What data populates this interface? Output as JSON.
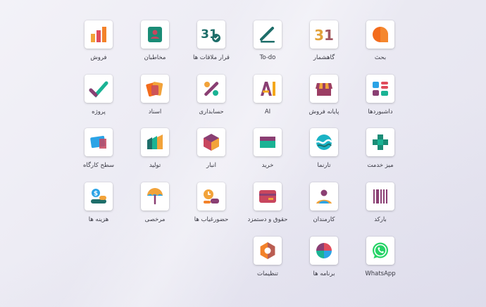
{
  "apps": [
    {
      "id": "discuss",
      "label": "بحث",
      "icon": "discuss-icon",
      "color": "#f36b1c"
    },
    {
      "id": "calendar",
      "label": "گاهشمار",
      "icon": "calendar-icon",
      "color": "#e2a23b"
    },
    {
      "id": "todo",
      "label": "To-do",
      "icon": "todo-icon",
      "color": "#1e6e6a"
    },
    {
      "id": "appointments",
      "label": "قرار ملاقات ها",
      "icon": "appointment-icon",
      "color": "#1e6e6a"
    },
    {
      "id": "contacts",
      "label": "مخاطبان",
      "icon": "contacts-icon",
      "color": "#1a8c76"
    },
    {
      "id": "sales",
      "label": "فروش",
      "icon": "sales-icon",
      "color": "#f2a33a"
    },
    {
      "id": "dashboards",
      "label": "داشبوردها",
      "icon": "dashboards-icon",
      "color": "#e04c5c"
    },
    {
      "id": "pos",
      "label": "پایانه فروش",
      "icon": "pos-icon",
      "color": "#9b3d63"
    },
    {
      "id": "ai",
      "label": "AI",
      "icon": "ai-icon",
      "color": "#f4a71b"
    },
    {
      "id": "accounting",
      "label": "حسابداری",
      "icon": "accounting-icon",
      "color": "#8a3f73"
    },
    {
      "id": "documents",
      "label": "اسناد",
      "icon": "documents-icon",
      "color": "#f3822a"
    },
    {
      "id": "project",
      "label": "پروژه",
      "icon": "project-icon",
      "color": "#1ab394"
    },
    {
      "id": "helpdesk",
      "label": "میز خدمت",
      "icon": "helpdesk-icon",
      "color": "#1a8c76"
    },
    {
      "id": "website",
      "label": "تارنما",
      "icon": "website-icon",
      "color": "#1ab3c5"
    },
    {
      "id": "purchase",
      "label": "خرید",
      "icon": "purchase-icon",
      "color": "#1ab394"
    },
    {
      "id": "inventory",
      "label": "انبار",
      "icon": "inventory-icon",
      "color": "#8a3f73"
    },
    {
      "id": "manufacturing",
      "label": "تولید",
      "icon": "manufacturing-icon",
      "color": "#1ab394"
    },
    {
      "id": "shopfloor",
      "label": "سطح کارگاه",
      "icon": "shopfloor-icon",
      "color": "#2ba3e6"
    },
    {
      "id": "barcode",
      "label": "بارکد",
      "icon": "barcode-icon",
      "color": "#8a3f73"
    },
    {
      "id": "employees",
      "label": "کارمندان",
      "icon": "employees-icon",
      "color": "#8a3f73"
    },
    {
      "id": "payroll",
      "label": "حقوق و دستمزد",
      "icon": "payroll-icon",
      "color": "#c8465e"
    },
    {
      "id": "attendances",
      "label": "حضورغیاب ها",
      "icon": "attendances-icon",
      "color": "#f2a33a"
    },
    {
      "id": "timeoff",
      "label": "مرخصی",
      "icon": "timeoff-icon",
      "color": "#f2a33a"
    },
    {
      "id": "expenses",
      "label": "هزینه ها",
      "icon": "expenses-icon",
      "color": "#2ba3e6"
    },
    {
      "id": "whatsapp",
      "label": "WhatsApp",
      "icon": "whatsapp-icon",
      "color": "#25d366"
    },
    {
      "id": "apps",
      "label": "برنامه ها",
      "icon": "apps-icon",
      "color": "#e04c5c"
    },
    {
      "id": "settings",
      "label": "تنظیمات",
      "icon": "settings-icon",
      "color": "#f3822a"
    }
  ]
}
